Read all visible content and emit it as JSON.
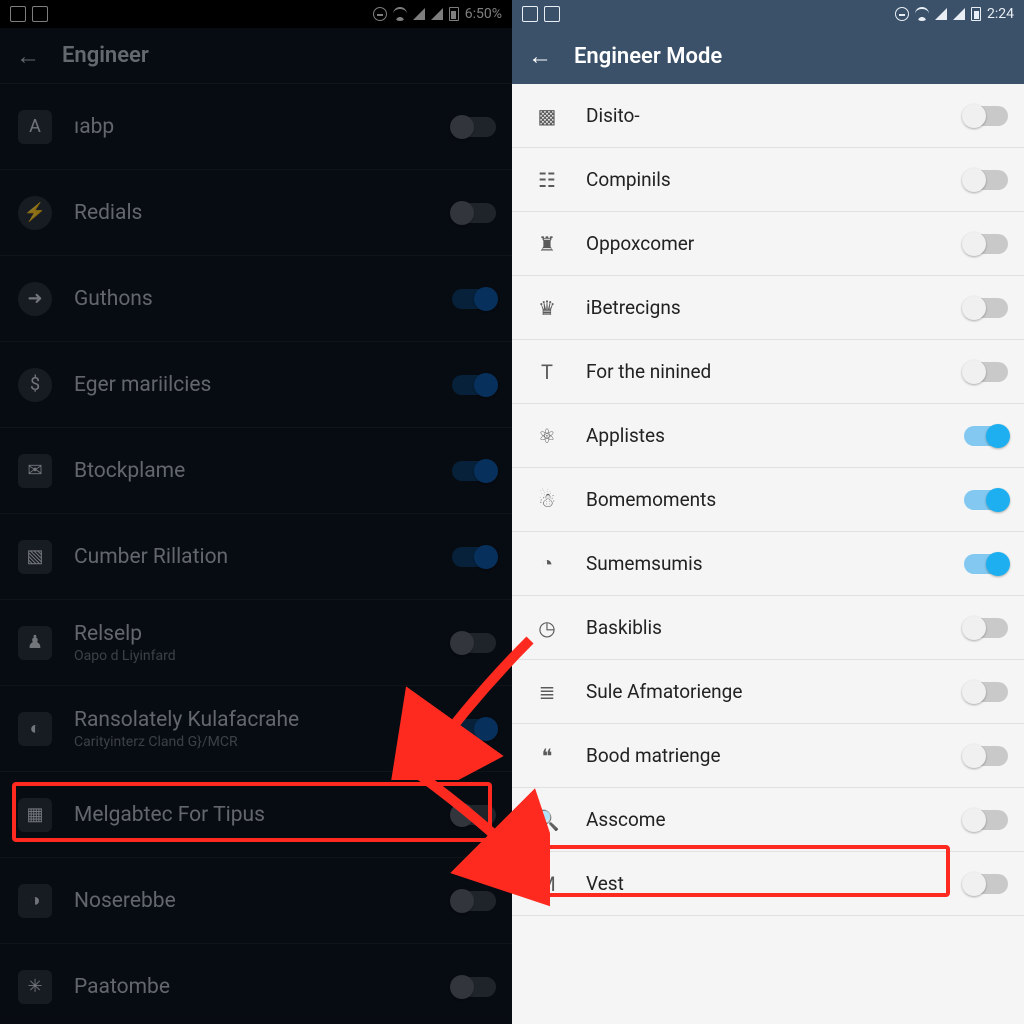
{
  "left": {
    "status": {
      "time": "6:50%"
    },
    "appbar": {
      "title": "Engineer"
    },
    "rows": [
      {
        "icon": "A",
        "label": "ıabp",
        "on": false
      },
      {
        "icon": "⚡",
        "label": "Redials",
        "on": false
      },
      {
        "icon": "➜",
        "label": "Guthons",
        "on": true
      },
      {
        "icon": "$",
        "label": "Eger mariilcies",
        "on": true
      },
      {
        "icon": "✉",
        "label": "Btockplame",
        "on": true
      },
      {
        "icon": "▧",
        "label": "Cumber Rillation",
        "on": true
      },
      {
        "icon": "♟",
        "label": "Relselp",
        "sub": "Oapo d Liyinfard",
        "on": false
      },
      {
        "icon": "◐",
        "label": "Ransolately Kulafacrahe",
        "sub": "Carityinterz Cland G}/MCR",
        "on": true
      },
      {
        "icon": "▦",
        "label": "Melgabtec For Tipus",
        "on": false,
        "highlight": true
      },
      {
        "icon": "◑",
        "label": "Noserebbe",
        "on": false
      },
      {
        "icon": "✳",
        "label": "Paatombe",
        "on": false
      }
    ]
  },
  "right": {
    "status": {
      "time": "2:24"
    },
    "appbar": {
      "title": "Engineer Mode"
    },
    "rows": [
      {
        "icon": "▩",
        "label": "Disito-",
        "on": false
      },
      {
        "icon": "☷",
        "label": "Compinils",
        "on": false
      },
      {
        "icon": "♜",
        "label": "Oppoxcomer",
        "on": false
      },
      {
        "icon": "♛",
        "label": "iBetrecigns",
        "on": false
      },
      {
        "icon": "T",
        "label": "For the ninined",
        "on": false
      },
      {
        "icon": "⚛",
        "label": "Applistes",
        "on": true
      },
      {
        "icon": "☃",
        "label": "Bomemoments",
        "on": true
      },
      {
        "icon": "◔",
        "label": "Sumemsumis",
        "on": true
      },
      {
        "icon": "◷",
        "label": "Baskiblis",
        "on": false
      },
      {
        "icon": "≣",
        "label": "Sule Afmatorienge",
        "on": false
      },
      {
        "icon": "❝",
        "label": "Bood matrienge",
        "on": false,
        "highlight": true
      },
      {
        "icon": "🔍",
        "label": "Asscome",
        "on": false
      },
      {
        "icon": "M",
        "label": "Vest",
        "on": false
      }
    ]
  },
  "colors": {
    "accent_left": "#0d5aa8",
    "accent_right": "#1daff0",
    "highlight": "#ff2a1f"
  }
}
